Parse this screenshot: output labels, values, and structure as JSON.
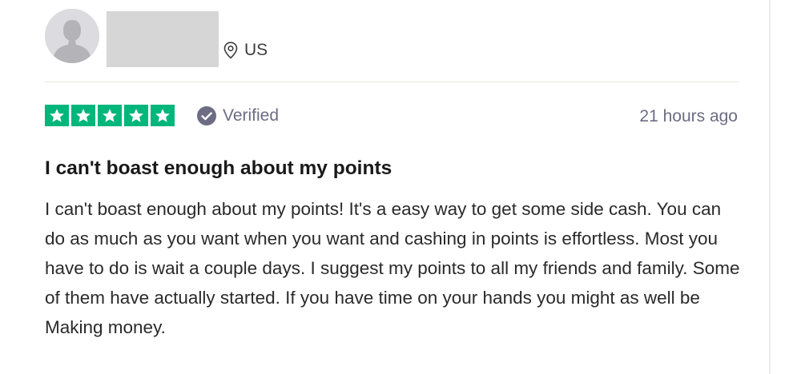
{
  "reviewer": {
    "location": "US"
  },
  "rating": {
    "stars": 5,
    "max_stars": 5,
    "star_color": "#00b67a",
    "verified_label": "Verified",
    "timestamp": "21 hours ago"
  },
  "review": {
    "title": "I can't boast enough about my points",
    "body": "I can't boast enough about my points! It's a easy way to get some side cash. You can do as much as you want when you want and cashing in points is effortless. Most you have to do is wait a couple days. I suggest my points to all my friends and family. Some of them have actually started. If you have time on your hands you might as well be Making money."
  },
  "icons": {
    "avatar": "user-silhouette-icon",
    "location": "map-pin-icon",
    "verified": "check-circle-icon",
    "star": "star-icon"
  }
}
